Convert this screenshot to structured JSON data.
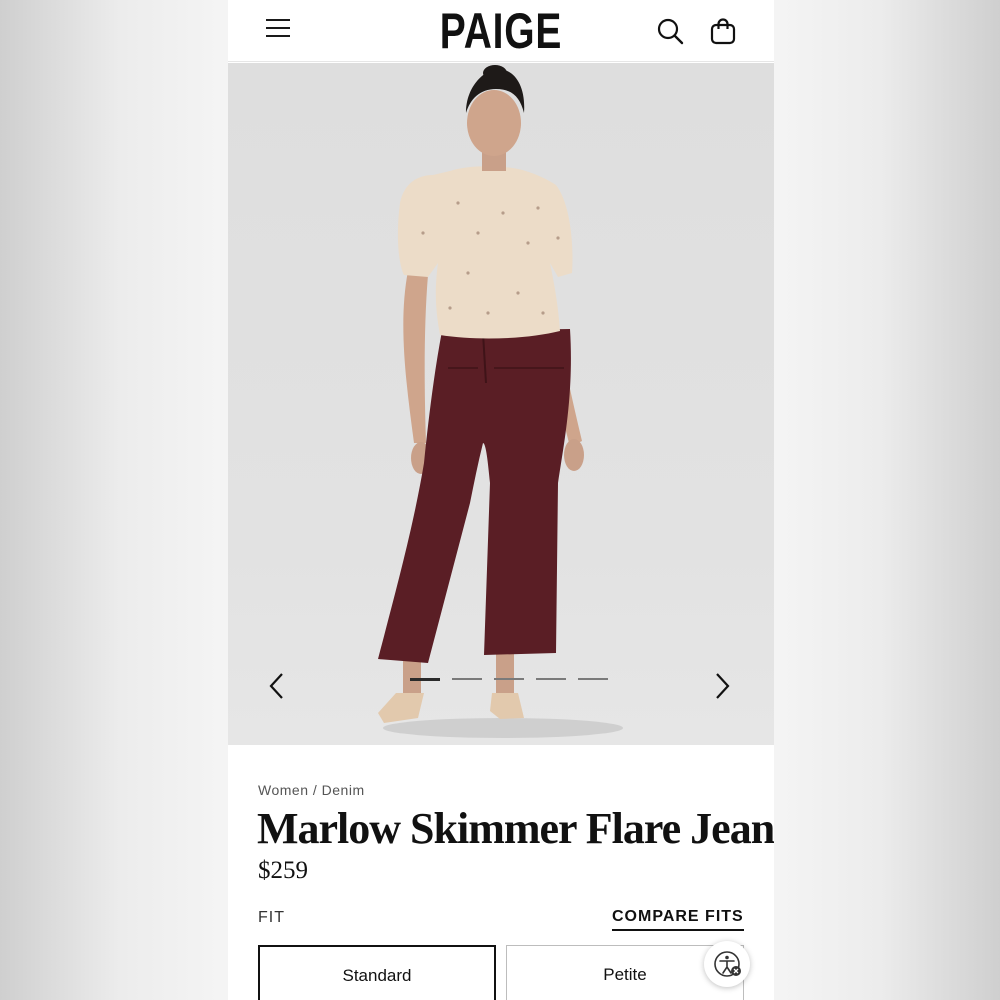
{
  "header": {
    "logo": "PAIGE",
    "menu_icon": "hamburger-menu-icon",
    "search_icon": "search-icon",
    "bag_icon": "shopping-bag-icon"
  },
  "gallery": {
    "image_description": "model-photo",
    "slide_count": 5,
    "active_slide": 1,
    "prev_icon": "chevron-left-icon",
    "next_icon": "chevron-right-icon"
  },
  "product": {
    "breadcrumb": [
      "Women",
      "Denim"
    ],
    "breadcrumb_separator": "/",
    "title": "Marlow Skimmer Flare Jean",
    "price": "$259",
    "fit_label": "FIT",
    "compare_fits": "COMPARE FITS",
    "fits": [
      "Standard",
      "Petite"
    ],
    "selected_fit": "Standard"
  },
  "accessibility": {
    "icon": "accessibility-icon"
  },
  "colors": {
    "jean": "#5a1e25",
    "sweater": "#ecdcc8",
    "background": "#e0e0e0"
  }
}
